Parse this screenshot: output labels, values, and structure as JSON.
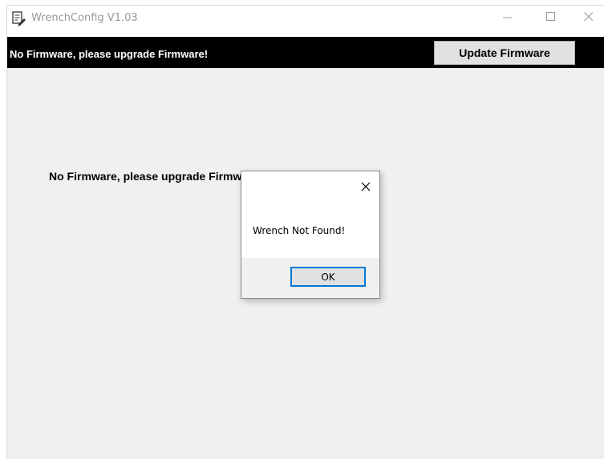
{
  "window": {
    "title": "WrenchConfig V1.03",
    "icon": "app-edit-icon",
    "controls": {
      "minimize": "minimize-icon",
      "maximize": "maximize-icon",
      "close": "close-icon"
    }
  },
  "banner": {
    "message": "No Firmware, please upgrade Firmware!",
    "update_button": "Update Firmware"
  },
  "main": {
    "message": "No Firmware, please upgrade Firmware!"
  },
  "dialog": {
    "message": "Wrench Not Found!",
    "ok_button": "OK",
    "close_icon": "close-icon"
  }
}
